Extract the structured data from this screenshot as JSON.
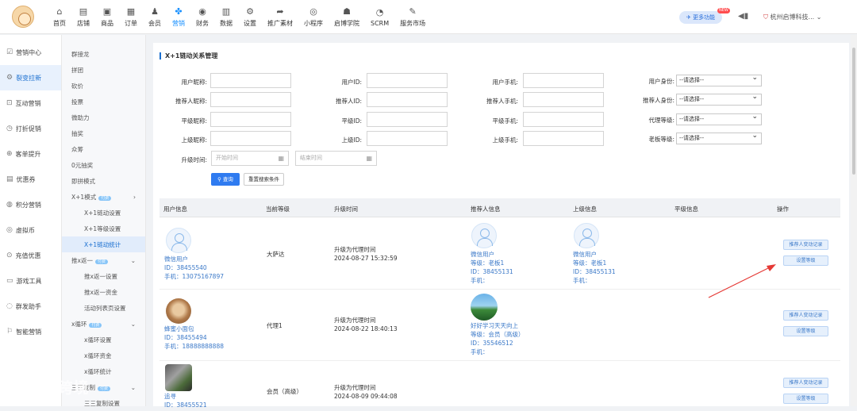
{
  "topnav": {
    "items": [
      {
        "icon": "home-icon",
        "glyph": "⌂",
        "label": "首页"
      },
      {
        "icon": "store-icon",
        "glyph": "▤",
        "label": "店铺"
      },
      {
        "icon": "goods-icon",
        "glyph": "▣",
        "label": "商品"
      },
      {
        "icon": "order-icon",
        "glyph": "▦",
        "label": "订单"
      },
      {
        "icon": "member-icon",
        "glyph": "♟",
        "label": "会员"
      },
      {
        "icon": "marketing-icon",
        "glyph": "✤",
        "label": "营销"
      },
      {
        "icon": "finance-icon",
        "glyph": "◉",
        "label": "财务"
      },
      {
        "icon": "data-icon",
        "glyph": "▥",
        "label": "数据"
      },
      {
        "icon": "settings-icon",
        "glyph": "⚙",
        "label": "设置"
      },
      {
        "icon": "promo-icon",
        "glyph": "➦",
        "label": "推广素材"
      },
      {
        "icon": "miniprogram-icon",
        "glyph": "◎",
        "label": "小程序"
      },
      {
        "icon": "academy-icon",
        "glyph": "☗",
        "label": "启博学院"
      },
      {
        "icon": "scrm-icon",
        "glyph": "◔",
        "label": "SCRM"
      },
      {
        "icon": "service-market-icon",
        "glyph": "✎",
        "label": "服务市场"
      }
    ],
    "active_index": 5,
    "more_label": "更多功能",
    "more_badge": "NEW",
    "company": "杭州启博科技..."
  },
  "sidebar": {
    "items": [
      {
        "label": "营销中心",
        "glyph": "☑"
      },
      {
        "label": "裂变拉新",
        "glyph": "⚙"
      },
      {
        "label": "互动营销",
        "glyph": "⊡"
      },
      {
        "label": "打折促销",
        "glyph": "◷"
      },
      {
        "label": "客单提升",
        "glyph": "⊕"
      },
      {
        "label": "优惠券",
        "glyph": "▤"
      },
      {
        "label": "积分营销",
        "glyph": "◍"
      },
      {
        "label": "虚拟币",
        "glyph": "◎"
      },
      {
        "label": "充值优惠",
        "glyph": "⊙"
      },
      {
        "label": "游戏工具",
        "glyph": "▭"
      },
      {
        "label": "群发助手",
        "glyph": "◌"
      },
      {
        "label": "智能营销",
        "glyph": "⚐"
      }
    ],
    "active_index": 1
  },
  "submenu": {
    "items": [
      {
        "label": "群接龙",
        "indent": false
      },
      {
        "label": "拼团",
        "indent": false
      },
      {
        "label": "砍价",
        "indent": false
      },
      {
        "label": "投票",
        "indent": false
      },
      {
        "label": "微助力",
        "indent": false
      },
      {
        "label": "抽奖",
        "indent": false
      },
      {
        "label": "众筹",
        "indent": false
      },
      {
        "label": "0元抽奖",
        "indent": false
      },
      {
        "label": "即拼模式",
        "indent": false
      },
      {
        "label": "X+1模式",
        "indent": false,
        "tag": "付费",
        "chev": "›"
      },
      {
        "label": "X+1链动设置",
        "indent": true
      },
      {
        "label": "X+1等级设置",
        "indent": true
      },
      {
        "label": "X+1链动统计",
        "indent": true,
        "selected": true
      },
      {
        "label": "推x返一",
        "indent": false,
        "tag": "付费",
        "chev": "⌄"
      },
      {
        "label": "推x返一设置",
        "indent": true
      },
      {
        "label": "推x返一资金",
        "indent": true
      },
      {
        "label": "活动列表页设置",
        "indent": true
      },
      {
        "label": "x循环",
        "indent": false,
        "tag": "付费",
        "chev": "⌄"
      },
      {
        "label": "x循环设置",
        "indent": true
      },
      {
        "label": "x循环资金",
        "indent": true
      },
      {
        "label": "x循环统计",
        "indent": true
      },
      {
        "label": "三三复制",
        "indent": false,
        "tag": "付费",
        "chev": "⌄"
      },
      {
        "label": "三三复制设置",
        "indent": true
      }
    ]
  },
  "page": {
    "title": "X+1链动关系管理",
    "filters": {
      "nickname_label": "用户昵称:",
      "userid_label": "用户ID:",
      "phone_label": "用户手机:",
      "identity_label": "用户身份:",
      "ref_nickname_label": "推荐人昵称:",
      "ref_id_label": "推荐人ID:",
      "ref_phone_label": "推荐人手机:",
      "ref_identity_label": "推荐人身份:",
      "peer_nickname_label": "平级昵称:",
      "peer_id_label": "平级ID:",
      "peer_phone_label": "平级手机:",
      "agent_level_label": "代理等级:",
      "up_nickname_label": "上级昵称:",
      "up_id_label": "上级ID:",
      "up_phone_label": "上级手机:",
      "boss_level_label": "老板等级:",
      "select_placeholder": "--请选择--",
      "upgrade_time_label": "升级时间:",
      "start_placeholder": "开始时间",
      "end_placeholder": "结束时间",
      "search_button": "查询",
      "reset_button": "重置搜索条件"
    },
    "table": {
      "headers": [
        "用户信息",
        "当前等级",
        "升级时间",
        "推荐人信息",
        "上级信息",
        "平级信息",
        "操作"
      ],
      "rows": [
        {
          "user": {
            "name": "微信用户",
            "id": "ID：38455540",
            "phone": "手机：13075167897"
          },
          "level": "大萨达",
          "time_title": "升级为代理时间",
          "time": "2024-08-27 15:32:59",
          "ref": {
            "name": "微信用户",
            "grade": "等级：老板1",
            "id": "ID：38455131",
            "phone": "手机："
          },
          "up": {
            "name": "微信用户",
            "grade": "等级：老板1",
            "id": "ID：38455131",
            "phone": "手机："
          },
          "op1": "推荐人变动记录",
          "op2": "设置等级"
        },
        {
          "user": {
            "name": "蜂蜜小面包",
            "id": "ID：38455494",
            "phone": "手机：18888888888"
          },
          "level": "代理1",
          "time_title": "升级为代理时间",
          "time": "2024-08-22 18:40:13",
          "ref": {
            "name": "好好学习天天向上",
            "grade": "等级：会员（高级）",
            "id": "ID：35546512",
            "phone": "手机："
          },
          "op1": "推荐人变动记录",
          "op2": "设置等级"
        },
        {
          "user": {
            "name": "追寻",
            "id": "ID：38455521"
          },
          "level": "会员（高级）",
          "time_title": "升级为代理时间",
          "time": "2024-08-09 09:44:08",
          "op1": "推荐人变动记录",
          "op2": "设置等级"
        }
      ]
    }
  },
  "watermark": "大数跨境"
}
